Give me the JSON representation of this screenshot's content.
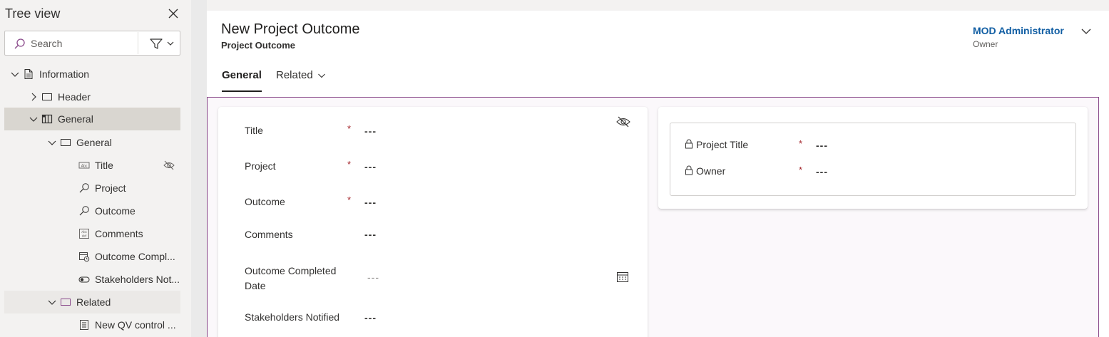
{
  "tree": {
    "title": "Tree view",
    "search_placeholder": "Search",
    "items": [
      {
        "label": "Information"
      },
      {
        "label": "Header"
      },
      {
        "label": "General"
      },
      {
        "label": "General"
      },
      {
        "label": "Title"
      },
      {
        "label": "Project"
      },
      {
        "label": "Outcome"
      },
      {
        "label": "Comments"
      },
      {
        "label": "Outcome Compl..."
      },
      {
        "label": "Stakeholders Not..."
      },
      {
        "label": "Related"
      },
      {
        "label": "New QV control ..."
      }
    ]
  },
  "header": {
    "title": "New Project Outcome",
    "subtitle": "Project Outcome",
    "owner_name": "MOD Administrator",
    "owner_role": "Owner"
  },
  "tabs": {
    "general": "General",
    "related": "Related"
  },
  "form": {
    "left_fields": [
      {
        "label": "Title",
        "required": "*",
        "value": "---"
      },
      {
        "label": "Project",
        "required": "*",
        "value": "---"
      },
      {
        "label": "Outcome",
        "required": "*",
        "value": "---"
      },
      {
        "label": "Comments",
        "value": "---"
      },
      {
        "label_line1": "Outcome Completed",
        "label_line2": "Date",
        "value": "---"
      },
      {
        "label": "Stakeholders Notified",
        "value": "---"
      }
    ],
    "right_fields": [
      {
        "label": "Project Title",
        "required": "*",
        "value": "---"
      },
      {
        "label": "Owner",
        "required": "*",
        "value": "---"
      }
    ]
  },
  "colors": {
    "accent_owner": "#115ea3",
    "required": "#a4262c",
    "canvas_border": "#8a4a8b",
    "selected_row": "#d9d6d0"
  }
}
